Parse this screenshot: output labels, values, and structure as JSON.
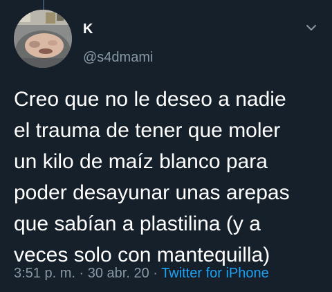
{
  "user": {
    "display_name": "K",
    "handle": "@s4dmami"
  },
  "tweet": {
    "text": "Creo que no le deseo a nadie\nel trauma de tener que moler\nun kilo de maíz blanco para\npoder desayunar unas arepas\nque sabían a plastilina (y a\nveces solo con mantequilla)",
    "time": "3:51 p. m.",
    "separator": "·",
    "date": "30 abr. 20",
    "source": "Twitter for iPhone"
  },
  "icons": {
    "more": "chevron-down-icon",
    "avatar": "avatar"
  },
  "colors": {
    "background": "#15202b",
    "primary_text": "#ffffff",
    "secondary_text": "#8899a6",
    "link": "#1da1f2"
  }
}
